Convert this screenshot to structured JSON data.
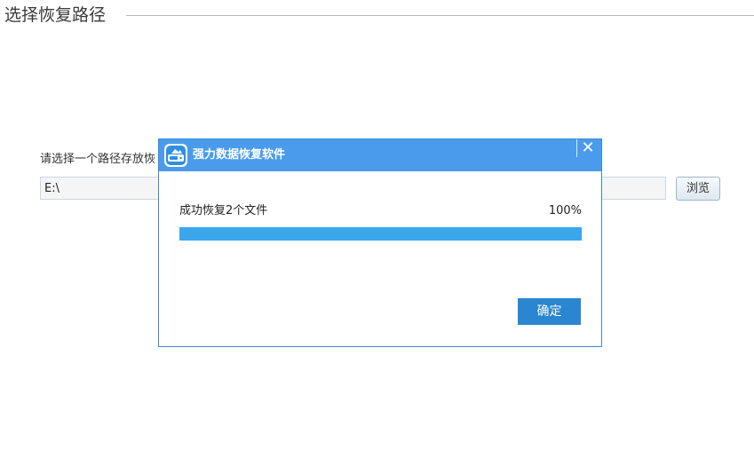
{
  "section": {
    "title": "选择恢复路径"
  },
  "path": {
    "prompt": "请选择一个路径存放恢",
    "value": "E:\\",
    "browse_label": "浏览"
  },
  "dialog": {
    "title": "强力数据恢复软件",
    "close_label": "✕",
    "status": "成功恢复2个文件",
    "progress_percent_text": "100%",
    "progress_value": 1.0,
    "ok_label": "确定"
  },
  "colors": {
    "titlebar": "#4a9bec",
    "progress_fill": "#3aa7ec",
    "ok_button": "#2a86d0"
  },
  "icons": {
    "dialog_logo": "hard-drive-icon",
    "close": "close-icon"
  }
}
